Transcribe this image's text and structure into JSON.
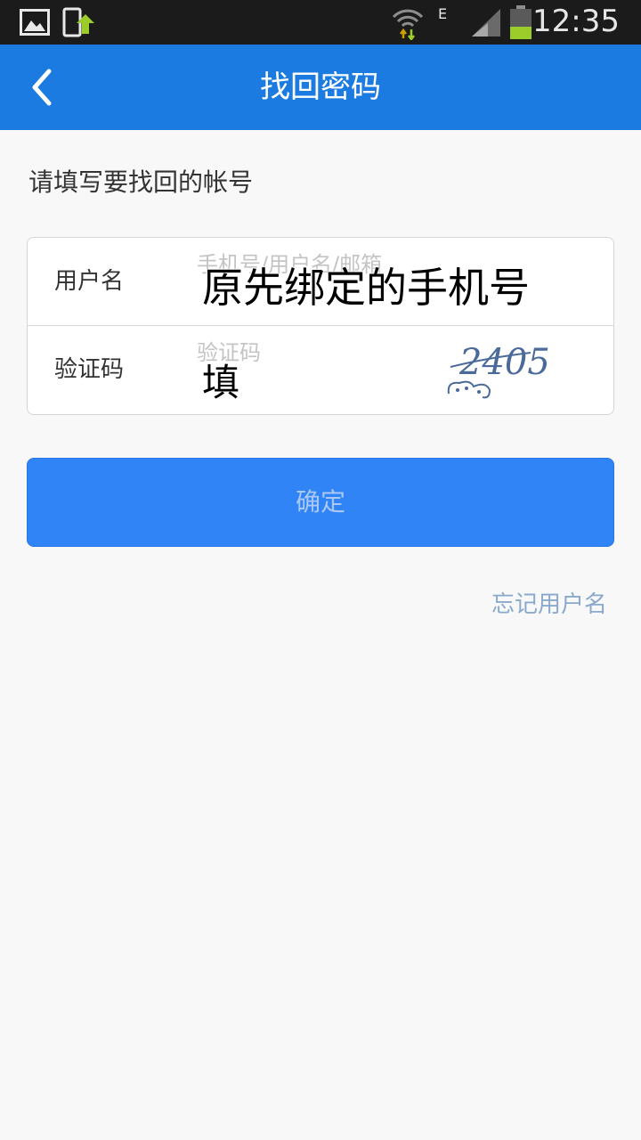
{
  "status_bar": {
    "time": "12:35",
    "network": "E",
    "icons": [
      "gallery-icon",
      "upload-icon",
      "wifi-icon",
      "signal-icon",
      "battery-icon"
    ]
  },
  "app_bar": {
    "title": "找回密码",
    "back_icon": "chevron-left-icon"
  },
  "hint": "请填写要找回的帐号",
  "form": {
    "username": {
      "label": "用户名",
      "placeholder": "手机号/用户名/邮箱",
      "overlay": "原先绑定的手机号"
    },
    "captcha": {
      "label": "验证码",
      "placeholder": "验证码",
      "overlay": "填",
      "image_text": "2405"
    }
  },
  "confirm_button": "确定",
  "forgot_username": "忘记用户名",
  "colors": {
    "app_bar": "#1b7be0",
    "button": "#3184f5",
    "link": "#8aa9cc"
  }
}
